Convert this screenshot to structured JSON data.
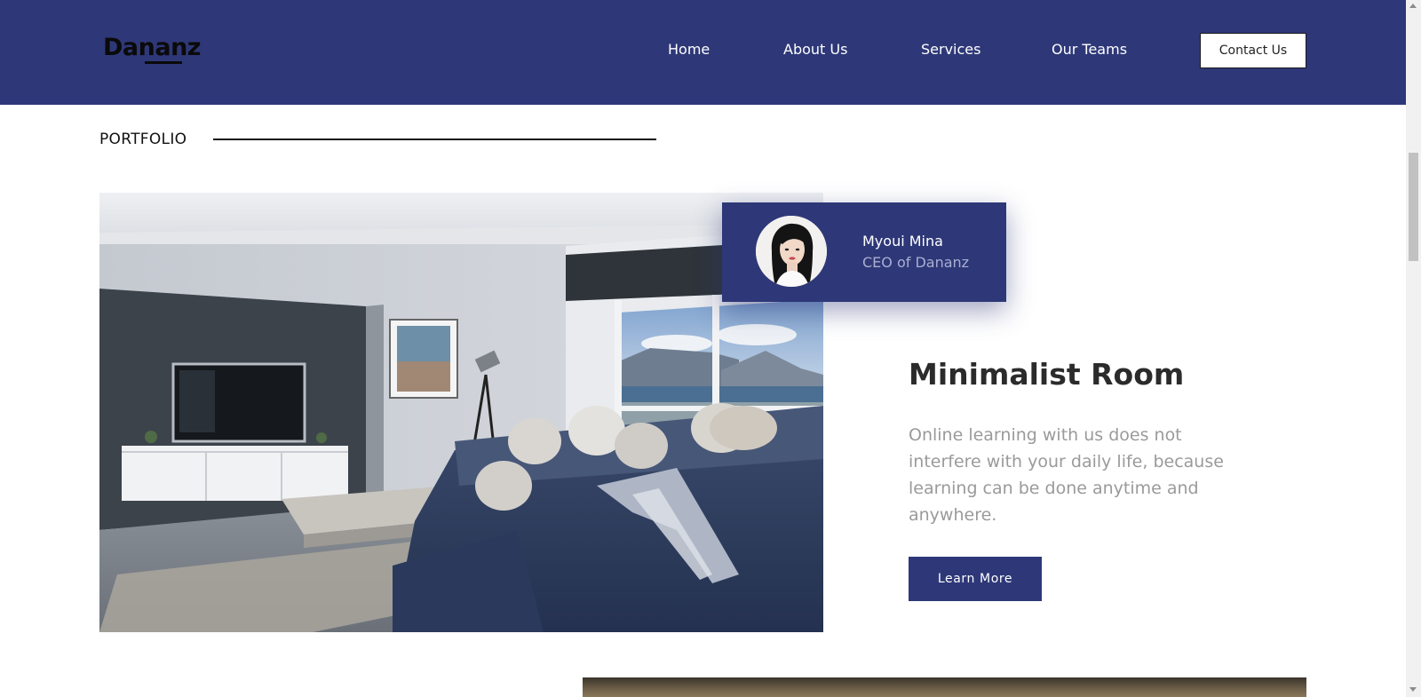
{
  "brand": {
    "logo_text": "Dananz"
  },
  "nav": {
    "items": [
      {
        "label": "Home"
      },
      {
        "label": "About Us"
      },
      {
        "label": "Services"
      },
      {
        "label": "Our Teams"
      }
    ],
    "contact_label": "Contact Us"
  },
  "section": {
    "label": "PORTFOLIO"
  },
  "profile": {
    "name": "Myoui Mina",
    "role": "CEO of Dananz"
  },
  "feature": {
    "title": "Minimalist Room",
    "description": "Online learning with us does not interfere with your daily life, because learning can be done anytime and anywhere.",
    "button_label": "Learn More"
  },
  "colors": {
    "primary": "#2e3878",
    "card_role_text": "#a9aed0",
    "body_text_muted": "#9a9a9a",
    "heading": "#2b2b2b"
  },
  "icons": [
    "scroll-up-arrow-icon",
    "scroll-down-arrow-icon"
  ]
}
